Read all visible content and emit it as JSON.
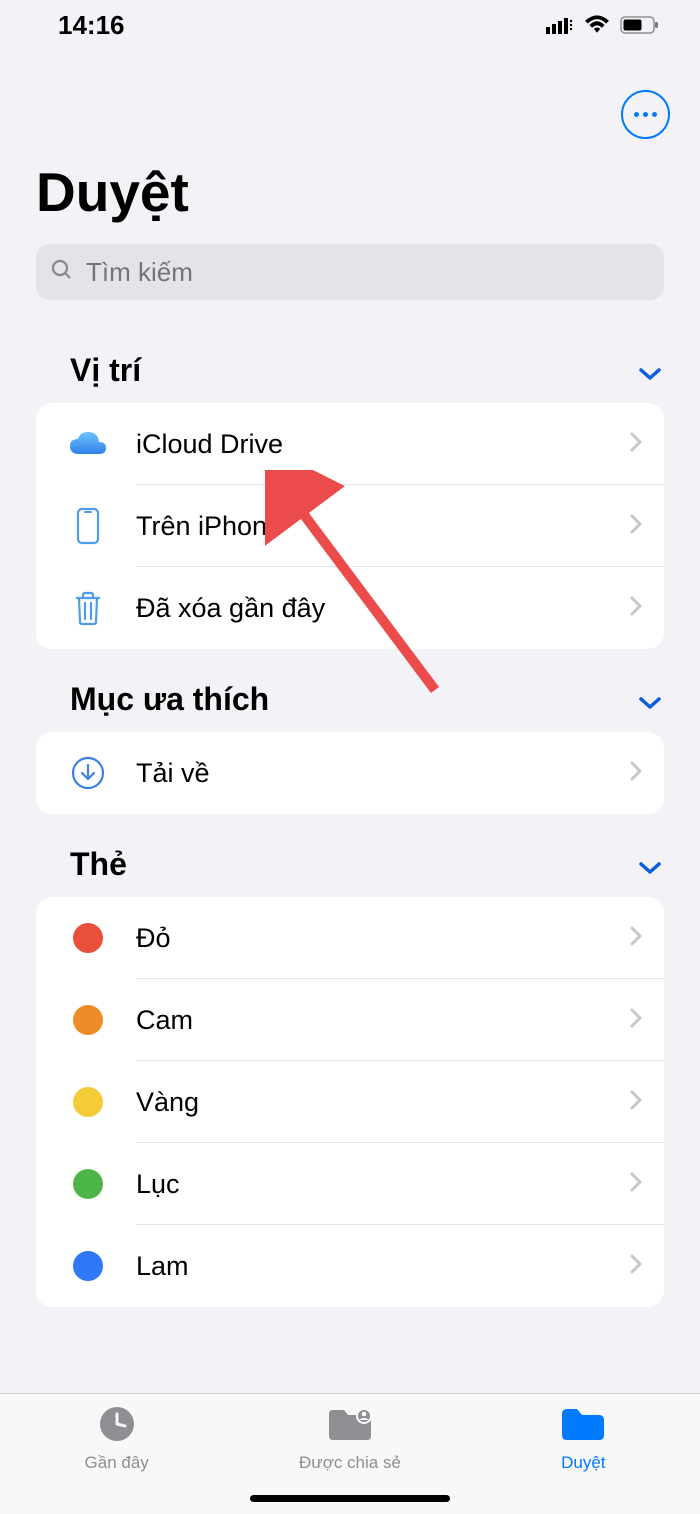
{
  "status": {
    "time": "14:16"
  },
  "page": {
    "title": "Duyệt"
  },
  "search": {
    "placeholder": "Tìm kiếm"
  },
  "sections": {
    "locations": {
      "title": "Vị trí",
      "items": [
        {
          "label": "iCloud Drive"
        },
        {
          "label": "Trên iPhone"
        },
        {
          "label": "Đã xóa gần đây"
        }
      ]
    },
    "favorites": {
      "title": "Mục ưa thích",
      "items": [
        {
          "label": "Tải về"
        }
      ]
    },
    "tags": {
      "title": "Thẻ",
      "items": [
        {
          "label": "Đỏ",
          "color": "#ea4f3b"
        },
        {
          "label": "Cam",
          "color": "#f08b2a"
        },
        {
          "label": "Vàng",
          "color": "#f4cc38"
        },
        {
          "label": "Lục",
          "color": "#4cb547"
        },
        {
          "label": "Lam",
          "color": "#2f78f5"
        }
      ]
    }
  },
  "tabs": {
    "recents": "Gần đây",
    "shared": "Được chia sẻ",
    "browse": "Duyệt"
  }
}
